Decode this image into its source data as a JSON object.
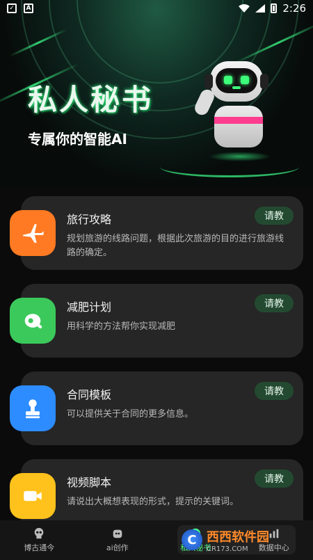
{
  "status_bar": {
    "time": "2:26"
  },
  "hero": {
    "title": "私人秘书",
    "subtitle": "专属你的智能AI"
  },
  "cards": [
    {
      "title": "旅行攻略",
      "desc": "规划旅游的线路问题，根据此次旅游的目的进行旅游线路的确定。",
      "button": "请教",
      "icon": "airplane-icon",
      "color": "#ff7a22"
    },
    {
      "title": "减肥计划",
      "desc": "用科学的方法帮你实现减肥",
      "button": "请教",
      "icon": "meat-icon",
      "color": "#3bc95b"
    },
    {
      "title": "合同模板",
      "desc": "可以提供关于合同的更多信息。",
      "button": "请教",
      "icon": "stamp-icon",
      "color": "#2d8cff"
    },
    {
      "title": "视频脚本",
      "desc": "请说出大概想表现的形式，提示的关键词。",
      "button": "请教",
      "icon": "video-camera-icon",
      "color": "#ffc21c"
    }
  ],
  "nav": [
    {
      "label": "博古通今",
      "icon": "skull-icon"
    },
    {
      "label": "ai创作",
      "icon": "robot-head-icon"
    },
    {
      "label": "私人秘书",
      "icon": "secretary-icon"
    },
    {
      "label": "数据中心",
      "icon": "data-icon"
    }
  ],
  "watermark": {
    "title": "西西软件园",
    "sub": "CR173.COM",
    "letter": "C"
  },
  "colors": {
    "accent": "#3dff8a",
    "card_bg": "#262626",
    "button_bg": "#234a31"
  }
}
